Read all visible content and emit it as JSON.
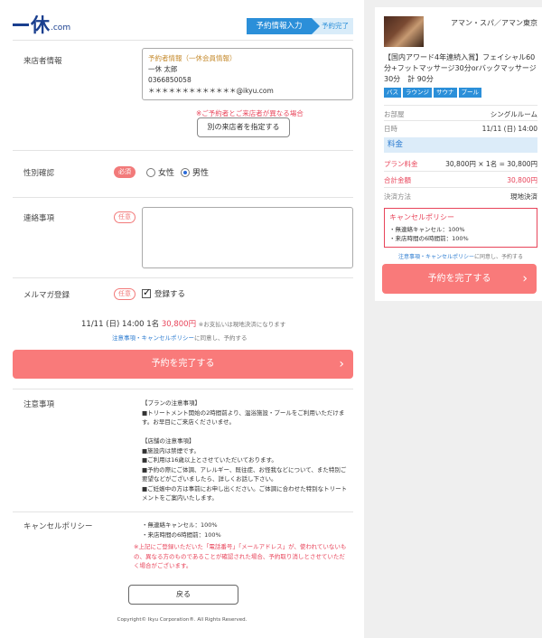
{
  "brand": {
    "logo_kanji": "休",
    "logo_suffix": ".com"
  },
  "steps": {
    "current": "予約情報入力",
    "next": "予約完了"
  },
  "guest": {
    "label": "来店者情報",
    "box_heading": "予約者情報（一休会員情報）",
    "name": "一休 太郎",
    "phone": "0366850058",
    "email_masked": "＊＊＊＊＊＊＊＊＊＊＊＊＊@ikyu.com",
    "note": "※ご予約者とご来店者が異なる場合",
    "other_button": "別の来店者を指定する"
  },
  "gender": {
    "label": "性別確認",
    "badge": "必須",
    "options": [
      "女性",
      "男性"
    ],
    "selected": "男性"
  },
  "contact": {
    "label": "連絡事項",
    "badge": "任意",
    "value": ""
  },
  "newsletter": {
    "label": "メルマガ登録",
    "badge": "任意",
    "checkbox_label": "登録する",
    "checked": true
  },
  "summary": {
    "date_time": "11/11 (日) 14:00 1名",
    "price": "30,800円",
    "payment_note": "※お支払いは現地決済になります",
    "agree_link1": "注意事項",
    "agree_sep": "・",
    "agree_link2": "キャンセルポリシー",
    "agree_suffix": "に同意し、予約する"
  },
  "cta": {
    "label": "予約を完了する"
  },
  "notice": {
    "label": "注意事項",
    "plan_head": "【プランの注意事項】",
    "plan_body": "■トリートメント開始の2時間前より、温浴施設・プールをご利用いただけます。お早目にご来店くださいませ。",
    "shop_head": "【店舗の注意事項】",
    "shop_1": "■施設内は禁煙です。",
    "shop_2": "■ご利用は16歳以上とさせていただいております。",
    "shop_3": "■予約の際にご体調、アレルギー、既往症、お怪我などについて、また特別ご要望などがございましたら、詳しくお話し下さい。",
    "shop_4": "■ご妊娠中の方は事前にお申し出ください。ご体調に合わせた特別なトリートメントをご案内いたします。"
  },
  "cancel": {
    "label": "キャンセルポリシー",
    "items": [
      "・無連絡キャンセル：100%",
      "・来店時間の6時間前：100%"
    ],
    "warning": "※上記にご登録いただいた「電話番号」「メールアドレス」が、使われていないもの、異なる方のものであることが確認された場合、予約取り消しとさせていただく場合がございます。"
  },
  "back_button": "戻る",
  "copyright": "Copyright© Ikyu Corporation®. All Rights Reserved.",
  "sidebar": {
    "hotel": "アマン・スパ／アマン東京",
    "plan": "【国内アワード4年連続入賞】フェイシャル60分+フットマッサージ30分orバックマッサージ30分　計 90分",
    "tags": [
      "バス",
      "ラウンジ",
      "サウナ",
      "プール"
    ],
    "room_label": "お部屋",
    "room_value": "シングルルーム",
    "date_label": "日時",
    "date_value": "11/11 (日) 14:00",
    "fee_head": "料金",
    "plan_fee_label": "プラン料金",
    "plan_fee_value": "30,800円 × 1名 = 30,800円",
    "total_label": "合計金額",
    "total_value": "30,800円",
    "pay_label": "決済方法",
    "pay_value": "現地決済",
    "cp_title": "キャンセルポリシー",
    "cp_items": [
      "・無連絡キャンセル：100%",
      "・来店時間の6時間前：100%"
    ],
    "agree_link1": "注意事項",
    "agree_sep": "・",
    "agree_link2": "キャンセルポリシー",
    "agree_suffix": "に同意し、予約する",
    "cta": "予約を完了する"
  },
  "colors": {
    "accent": "#2b8fd9",
    "cta": "#f97a7a",
    "alert": "#e8445a"
  }
}
